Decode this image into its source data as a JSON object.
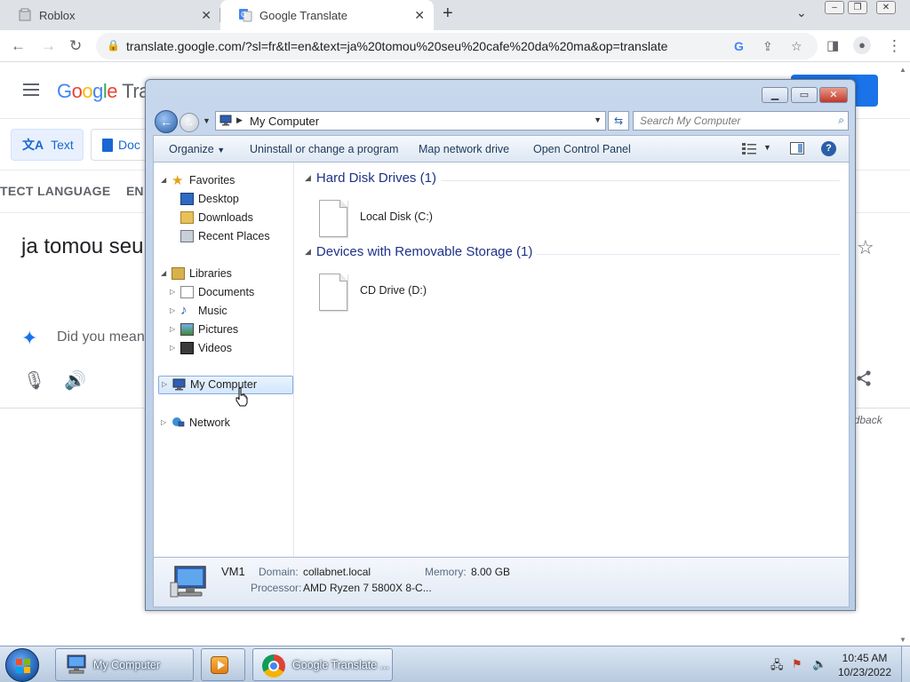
{
  "browser": {
    "tabs": [
      {
        "title": "Roblox"
      },
      {
        "title": "Google Translate"
      }
    ],
    "url": "translate.google.com/?sl=fr&tl=en&text=ja%20tomou%20seu%20cafe%20da%20ma&op=translate"
  },
  "translate_page": {
    "logo_text": "Google Tra",
    "modes": {
      "text": "Text",
      "docs": "Doc"
    },
    "source_lang": "TECT LANGUAGE",
    "target_lang": "EN",
    "source_text": "ja tomou seu",
    "did_you_mean": "Did you mean:",
    "feedback": "edback"
  },
  "explorer": {
    "address": "My Computer",
    "search_placeholder": "Search My Computer",
    "commands": {
      "organize": "Organize",
      "uninstall": "Uninstall or change a program",
      "map_drive": "Map network drive",
      "control_panel": "Open Control Panel"
    },
    "nav": {
      "favorites": "Favorites",
      "desktop": "Desktop",
      "downloads": "Downloads",
      "recent": "Recent Places",
      "libraries": "Libraries",
      "documents": "Documents",
      "music": "Music",
      "pictures": "Pictures",
      "videos": "Videos",
      "my_computer": "My Computer",
      "network": "Network"
    },
    "groups": [
      {
        "title": "Hard Disk Drives (1)",
        "items": [
          "Local Disk (C:)"
        ]
      },
      {
        "title": "Devices with Removable Storage (1)",
        "items": [
          "CD Drive (D:)"
        ]
      }
    ],
    "details": {
      "name": "VM1",
      "domain_label": "Domain:",
      "domain": "collabnet.local",
      "memory_label": "Memory:",
      "memory": "8.00 GB",
      "processor_label": "Processor:",
      "processor": "AMD Ryzen 7 5800X 8-C..."
    }
  },
  "taskbar": {
    "explorer_label": "My Computer",
    "chrome_label": "Google Translate ...",
    "time": "10:45 AM",
    "date": "10/23/2022"
  }
}
